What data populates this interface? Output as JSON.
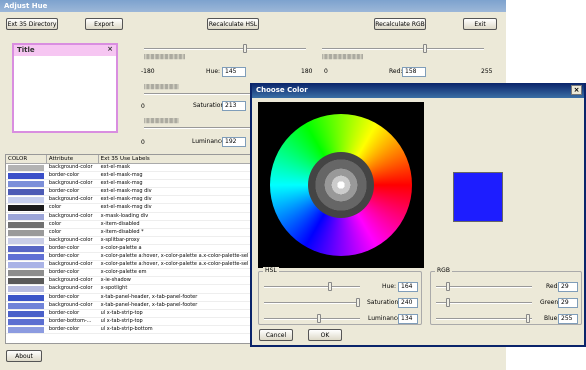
{
  "app": {
    "title": "Adjust Hue"
  },
  "toolbar": {
    "ext35": "Ext 35 Directory",
    "export": "Export",
    "recalc_hsl": "Recalculate HSL",
    "recalc_rgb": "Recalculate RGB",
    "exit": "Exit"
  },
  "hue": {
    "min": "-180",
    "max": "180",
    "label": "Hue:",
    "value": "145"
  },
  "red": {
    "min": "0",
    "max": "255",
    "label": "Red:",
    "value": "158"
  },
  "saturation": {
    "min": "0",
    "label": "Saturation:",
    "value": "213"
  },
  "luminance": {
    "min": "0",
    "label": "Luminance:",
    "value": "192"
  },
  "preview": {
    "title": "Title",
    "close": "×"
  },
  "grid": {
    "headers": [
      "COLOR",
      "Attribute",
      "Ext 35 Use Labels"
    ],
    "rows": [
      {
        "color": "#b3b3b3",
        "attr": "background-color",
        "use": "ext-el-mask"
      },
      {
        "color": "#3a4fc9",
        "attr": "border-color",
        "use": "ext-el-mask-msg"
      },
      {
        "color": "#7c8fd9",
        "attr": "background-color",
        "use": "ext-el-mask-msg"
      },
      {
        "color": "#4d5bb5",
        "attr": "border-color",
        "use": "ext-el-mask-msg div"
      },
      {
        "color": "#c8d0ee",
        "attr": "background-color",
        "use": "ext-el-mask-msg div"
      },
      {
        "color": "#1c1c1c",
        "attr": "color",
        "use": "ext-el-mask-msg div"
      },
      {
        "color": "#9ca5d8",
        "attr": "background-color",
        "use": "x-mask-loading div"
      },
      {
        "color": "#707070",
        "attr": "color",
        "use": "x-item-disabled"
      },
      {
        "color": "#9a9a9a",
        "attr": "color",
        "use": "x-item-disabled *"
      },
      {
        "color": "#c9cde6",
        "attr": "background-color",
        "use": "x-splitbar-proxy"
      },
      {
        "color": "#5866c4",
        "attr": "border-color",
        "use": "x-color-palette a"
      },
      {
        "color": "#6070d4",
        "attr": "border-color",
        "use": "x-color-palette a:hover,  x-color-palette a.x-color-palette-sel"
      },
      {
        "color": "#aab3e6",
        "attr": "background-color",
        "use": "x-color-palette a:hover,  x-color-palette a.x-color-palette-sel"
      },
      {
        "color": "#8d8d8d",
        "attr": "border-color",
        "use": "x-color-palette em"
      },
      {
        "color": "#5a5a5a",
        "attr": "background-color",
        "use": "x-ie-shadow"
      },
      {
        "color": "#b8bde0",
        "attr": "background-color",
        "use": "x-spotlight"
      },
      {
        "color": "#3b55c8",
        "attr": "border-color",
        "use": "x-tab-panel-header,  x-tab-panel-footer"
      },
      {
        "color": "#7083d8",
        "attr": "background-color",
        "use": "x-tab-panel-header,  x-tab-panel-footer"
      },
      {
        "color": "#4a60c9",
        "attr": "border-color",
        "use": "ul x-tab-strip-top"
      },
      {
        "color": "#5c6fd1",
        "attr": "border-bottom-...",
        "use": "ul x-tab-strip-top"
      },
      {
        "color": "#8c9be0",
        "attr": "border-color",
        "use": "ul x-tab-strip-bottom"
      }
    ]
  },
  "about": "About",
  "dialog": {
    "title": "Choose Color",
    "close": "×",
    "hsl": {
      "legend": "HSL",
      "hue_label": "Hue:",
      "hue": "164",
      "sat_label": "Saturation:",
      "sat": "240",
      "lum_label": "Luminance:",
      "lum": "134"
    },
    "rgb": {
      "legend": "RGB",
      "red_label": "Red:",
      "red": "29",
      "green_label": "Green:",
      "green": "29",
      "blue_label": "Blue:",
      "blue": "255"
    },
    "cancel": "Cancel",
    "ok": "OK",
    "swatch": "#1d1dff"
  }
}
